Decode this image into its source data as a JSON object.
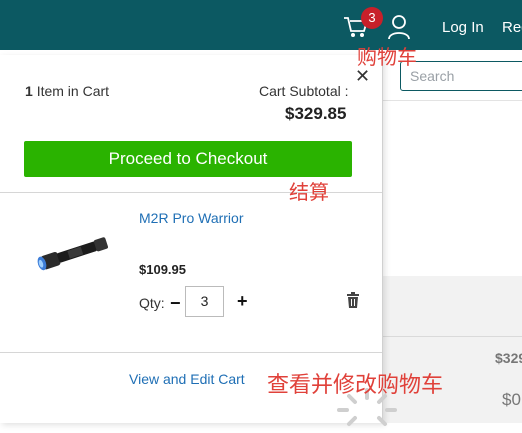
{
  "header": {
    "cart_count": "3",
    "login_label": "Log In",
    "register_label": "Reg",
    "search_placeholder": "Search"
  },
  "minicart": {
    "item_count": "1",
    "item_label": "Item in Cart",
    "subtotal_label": "Cart Subtotal :",
    "subtotal_value": "$329.85",
    "checkout_label": "Proceed to Checkout",
    "product": {
      "name": "M2R Pro Warrior",
      "price": "$109.95",
      "qty_label": "Qty:",
      "qty_value": "3"
    },
    "view_edit_label": "View and Edit Cart"
  },
  "background": {
    "price_partial_1": "$329",
    "price_partial_2": "$0"
  },
  "annotations": {
    "cart": "购物车",
    "checkout": "结算",
    "view_edit": "查看并修改购物车"
  },
  "colors": {
    "header_bg": "#0c5962",
    "checkout_bg": "#2ab300",
    "link": "#1f6fb5",
    "badge": "#c8202a",
    "annotation": "#e0413a"
  }
}
